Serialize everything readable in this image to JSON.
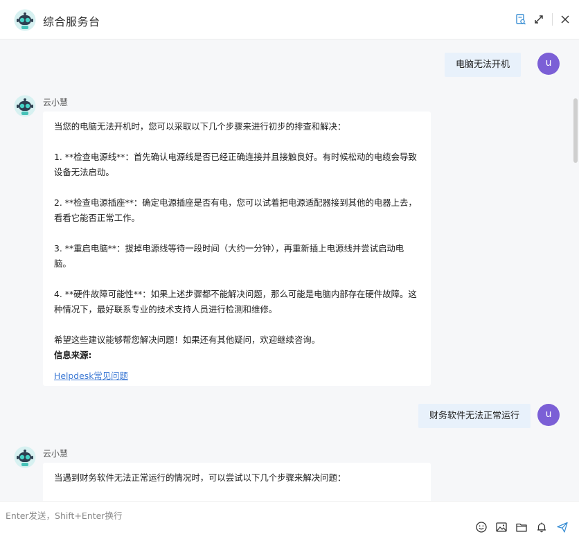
{
  "header": {
    "title": "综合服务台",
    "icons": [
      "robot-logo",
      "search-doc-icon",
      "expand-icon",
      "close-icon"
    ],
    "accent_color": "#3b8fd4"
  },
  "messages": [
    {
      "role": "user",
      "avatar": "u",
      "text": "电脑无法开机"
    },
    {
      "role": "bot",
      "name": "云小慧",
      "paragraphs": [
        "当您的电脑无法开机时，您可以采取以下几个步骤来进行初步的排查和解决：",
        "1. **检查电源线**：首先确认电源线是否已经正确连接并且接触良好。有时候松动的电缆会导致设备无法启动。",
        "2. **检查电源插座**：确定电源插座是否有电，您可以试着把电源适配器接到其他的电器上去，看看它能否正常工作。",
        "3. **重启电脑**：拔掉电源线等待一段时间（大约一分钟），再重新插上电源线并尝试启动电脑。",
        "4. **硬件故障可能性**：如果上述步骤都不能解决问题，那么可能是电脑内部存在硬件故障。这种情况下，最好联系专业的技术支持人员进行检测和维修。",
        "希望这些建议能够帮您解决问题！如果还有其他疑问，欢迎继续咨询。"
      ],
      "source_label": "信息来源:",
      "source_link": "Helpdesk常见问题"
    },
    {
      "role": "user",
      "avatar": "u",
      "text": "财务软件无法正常运行"
    },
    {
      "role": "bot",
      "name": "云小慧",
      "paragraphs": [
        "当遇到财务软件无法正常运行的情况时，可以尝试以下几个步骤来解决问题："
      ]
    }
  ],
  "input": {
    "placeholder": "Enter发送，Shift+Enter换行",
    "value": "",
    "tools": [
      "emoji-icon",
      "image-icon",
      "folder-icon",
      "bell-icon",
      "send-icon"
    ]
  },
  "colors": {
    "user_bubble": "#e8f1fb",
    "user_avatar": "#7b5fd6",
    "chat_bg": "#f6f7f9",
    "link": "#3b78d4"
  }
}
